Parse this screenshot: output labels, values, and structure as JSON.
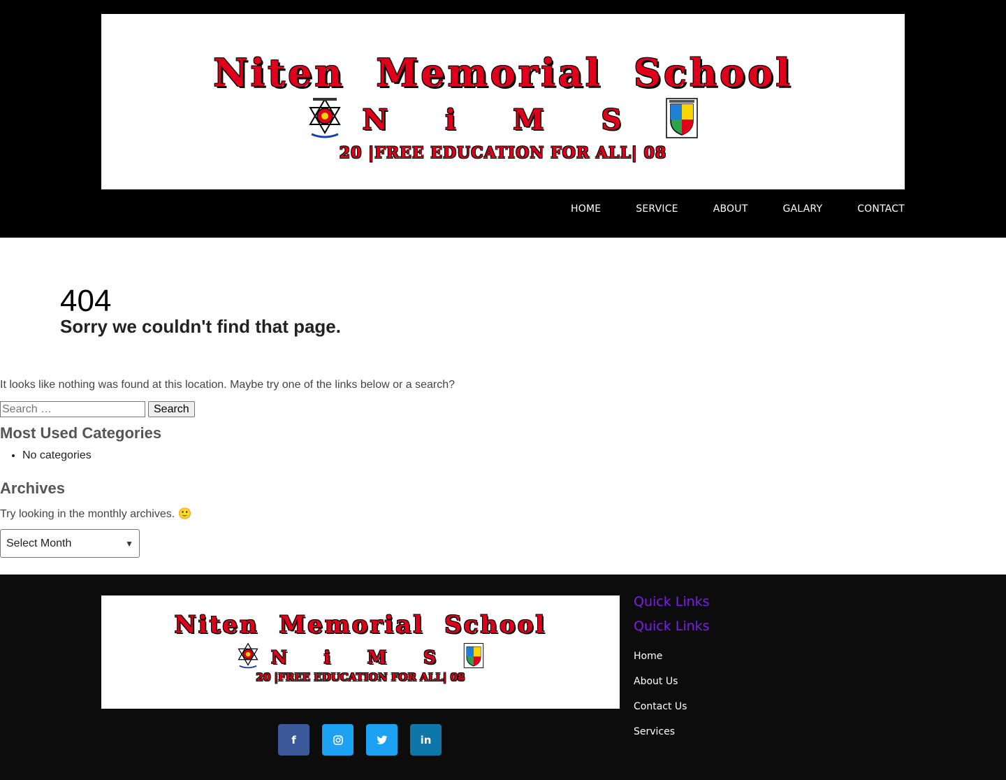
{
  "brand": {
    "title": "Niten Memorial School",
    "acronym": "N i M S",
    "tagline": "20 |FREE EDUCATION FOR ALL| 08",
    "text_color": "#e0001b"
  },
  "nav": {
    "items": [
      "HOME",
      "SERVICE",
      "ABOUT",
      "GALARY",
      "CONTACT"
    ]
  },
  "error": {
    "code": "404",
    "headline": "Sorry we couldn't find that page.",
    "message": "It looks like nothing was found at this location. Maybe try one of the links below or a search?"
  },
  "search": {
    "placeholder": "Search …",
    "button_label": "Search"
  },
  "categories": {
    "heading": "Most Used Categories",
    "empty": "No categories"
  },
  "archives": {
    "heading": "Archives",
    "message": "Try looking in the monthly archives. 🙂",
    "select_value": "Select Month"
  },
  "footer": {
    "social": [
      {
        "name": "facebook",
        "glyph": "f",
        "color": "#3b5998"
      },
      {
        "name": "instagram",
        "glyph": "◎",
        "color": "#1da1f2"
      },
      {
        "name": "twitter",
        "glyph": "🐦",
        "color": "#1da1f2"
      },
      {
        "name": "linkedin",
        "glyph": "in",
        "color": "#0e76a8"
      }
    ],
    "quick_links_title": "Quick Links",
    "quick_links_subtitle": "Quick Links",
    "links": [
      "Home",
      "About Us",
      "Contact Us",
      "Services"
    ],
    "accent": "#7b1fe8"
  }
}
